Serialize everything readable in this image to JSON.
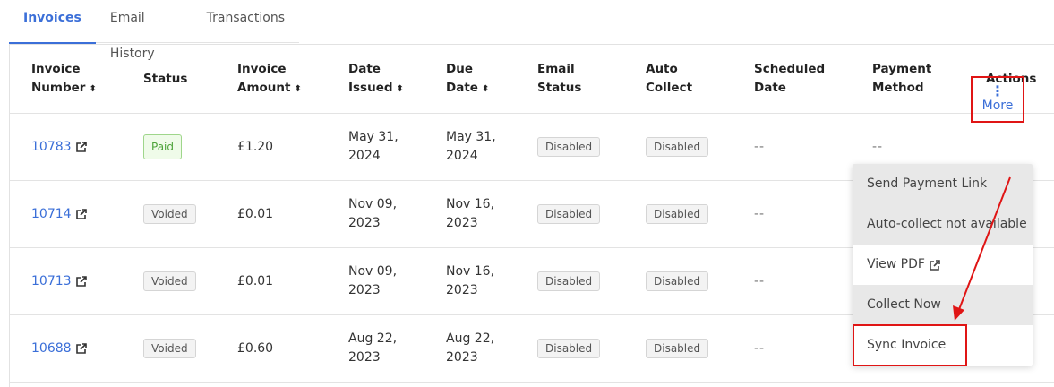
{
  "tabs": [
    {
      "label": "Invoices"
    },
    {
      "label": "Email History"
    },
    {
      "label": "Transactions"
    }
  ],
  "table": {
    "headers": {
      "invoice_number": [
        "Invoice",
        "Number"
      ],
      "status": "Status",
      "invoice_amount": [
        "Invoice",
        "Amount"
      ],
      "date_issued": [
        "Date",
        "Issued"
      ],
      "due_date": [
        "Due",
        "Date"
      ],
      "email_status": [
        "Email",
        "Status"
      ],
      "auto_collect": [
        "Auto",
        "Collect"
      ],
      "scheduled_date": [
        "Scheduled",
        "Date"
      ],
      "payment_method": [
        "Payment",
        "Method"
      ],
      "actions": "Actions"
    },
    "rows": [
      {
        "number": "10783",
        "status": "Paid",
        "amount": "£1.20",
        "issued": [
          "May 31,",
          "2024"
        ],
        "due": [
          "May 31,",
          "2024"
        ],
        "email_status": "Disabled",
        "auto_collect": "Disabled",
        "scheduled": "--",
        "payment_method": "--"
      },
      {
        "number": "10714",
        "status": "Voided",
        "amount": "£0.01",
        "issued": [
          "Nov 09,",
          "2023"
        ],
        "due": [
          "Nov 16,",
          "2023"
        ],
        "email_status": "Disabled",
        "auto_collect": "Disabled",
        "scheduled": "--"
      },
      {
        "number": "10713",
        "status": "Voided",
        "amount": "£0.01",
        "issued": [
          "Nov 09,",
          "2023"
        ],
        "due": [
          "Nov 16,",
          "2023"
        ],
        "email_status": "Disabled",
        "auto_collect": "Disabled",
        "scheduled": "--"
      },
      {
        "number": "10688",
        "status": "Voided",
        "amount": "£0.60",
        "issued": [
          "Aug 22,",
          "2023"
        ],
        "due": [
          "Aug 22,",
          "2023"
        ],
        "email_status": "Disabled",
        "auto_collect": "Disabled",
        "scheduled": "--"
      }
    ]
  },
  "actions": {
    "more_label": "More",
    "kebab_icon": "kebab-vertical-icon",
    "menu": [
      {
        "label": "Send Payment Link"
      },
      {
        "label": "Auto-collect not available"
      },
      {
        "label": "View PDF"
      },
      {
        "label": "Collect Now"
      },
      {
        "label": "Sync Invoice"
      }
    ]
  },
  "colors": {
    "accent": "#3b6fd8",
    "highlight": "#e01515",
    "paid_badge": "#4da33a"
  }
}
